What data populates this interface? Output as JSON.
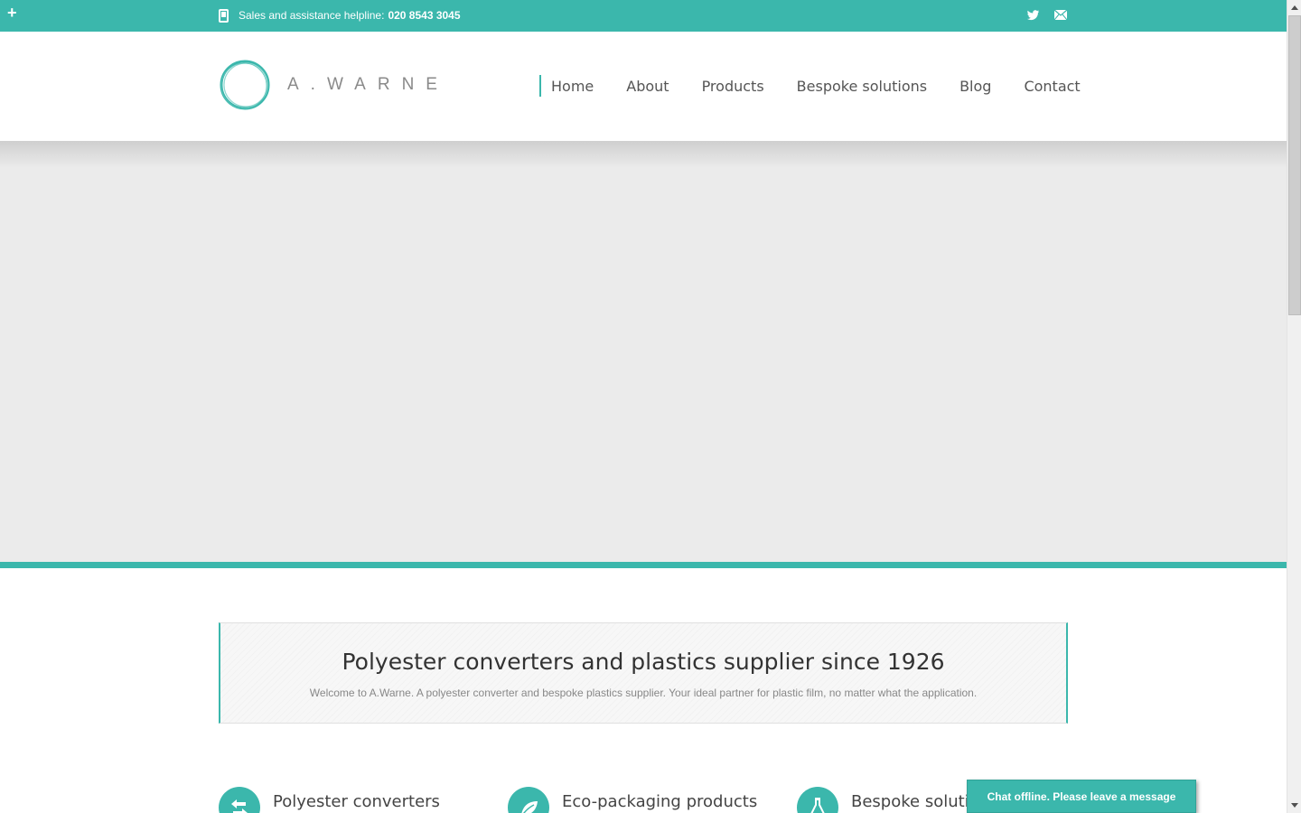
{
  "topbar": {
    "plus_icon": "+",
    "helpline_label": "Sales and assistance helpline:",
    "helpline_number": "020 8543 3045",
    "phone_icon": "mobile-phone-icon",
    "twitter_icon": "twitter-icon",
    "mail_icon": "mail-icon"
  },
  "header": {
    "logo_text": "A.WARNE",
    "nav": [
      "Home",
      "About",
      "Products",
      "Bespoke solutions",
      "Blog",
      "Contact"
    ]
  },
  "intro": {
    "title": "Polyester converters and plastics supplier since 1926",
    "subtitle": "Welcome to A.Warne. A polyester converter and bespoke plastics supplier. Your ideal partner for plastic film, no matter what the application."
  },
  "features": [
    {
      "label": "Polyester converters",
      "icon": "arrows-exchange-icon"
    },
    {
      "label": "Eco-packaging products",
      "icon": "leaf-icon"
    },
    {
      "label": "Bespoke solutio",
      "icon": "flask-icon"
    }
  ],
  "chat": {
    "label": "Chat offline. Please leave a message"
  },
  "colors": {
    "accent": "#3bb7ac",
    "hero_bg": "#ebebeb",
    "text": "#555555"
  }
}
